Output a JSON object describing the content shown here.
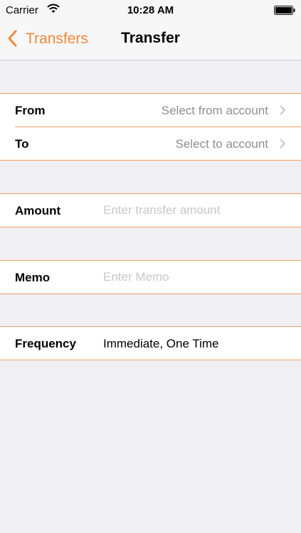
{
  "status_bar": {
    "carrier": "Carrier",
    "time": "10:28 AM"
  },
  "nav": {
    "back_label": "Transfers",
    "title": "Transfer"
  },
  "accounts": {
    "from_label": "From",
    "from_value": "Select from account",
    "to_label": "To",
    "to_value": "Select to account"
  },
  "amount": {
    "label": "Amount",
    "placeholder": "Enter transfer amount"
  },
  "memo": {
    "label": "Memo",
    "placeholder": "Enter Memo"
  },
  "frequency": {
    "label": "Frequency",
    "value": "Immediate, One Time"
  },
  "colors": {
    "accent": "#f0893a",
    "separator": "#f0a060",
    "background": "#efeff4",
    "placeholder": "#c7c7cd"
  },
  "icons": [
    "wifi-icon",
    "battery-icon",
    "back-chevron-icon",
    "disclosure-icon"
  ]
}
